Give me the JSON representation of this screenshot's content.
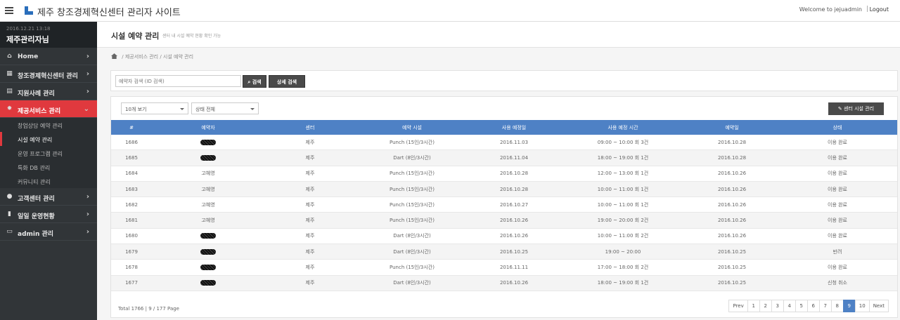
{
  "topbar": {
    "title": "제주 창조경제혁신센터 관리자 사이트",
    "welcome": "Welcome to jejuadmin",
    "separator": "|",
    "logout": "Logout"
  },
  "sidebar": {
    "date": "2016.12.21 13:18",
    "user": "제주관리자님",
    "items": [
      {
        "label": "Home",
        "icon": "home-icon"
      },
      {
        "label": "창조경제혁신센터 관리",
        "icon": "building-icon"
      },
      {
        "label": "지원사례 관리",
        "icon": "document-icon"
      },
      {
        "label": "제공서비스 관리",
        "icon": "gear-icon"
      },
      {
        "label": "고객센터 관리",
        "icon": "user-icon"
      },
      {
        "label": "일일 운영현황",
        "icon": "chart-icon"
      },
      {
        "label": "admin 관리",
        "icon": "monitor-icon"
      }
    ],
    "submenu": [
      "창업상담 예약 관리",
      "시설 예약 관리",
      "운영 프로그램 관리",
      "특화 DB 관리",
      "커뮤니티 관리"
    ],
    "active_color": "#e0393e"
  },
  "page": {
    "title": "시설 예약 관리",
    "subtitle": "센터 내 시설 예약 현황 확인 가능",
    "breadcrumb": "/ 제공서비스 관리 / 시설 예약 관리"
  },
  "search": {
    "placeholder": "예약자 검색 (ID 검색)",
    "search_button": "검색",
    "advanced_button": "상세 검색"
  },
  "filters": {
    "count": "10개 보기",
    "status": "상태 전체",
    "manage_button": "센터 시설 관리"
  },
  "table": {
    "header_color": "#4e81c5",
    "columns": [
      "#",
      "예약자",
      "센터",
      "예약 시설",
      "사용 예정일",
      "사용 예정 시간",
      "예약일",
      "상태"
    ],
    "rows": [
      [
        "1686",
        "",
        "제주",
        "Punch (15인/3시간)",
        "2016.11.03",
        "09:00 ~ 10:00 회 3건",
        "2016.10.28",
        "이용 완료"
      ],
      [
        "1685",
        "",
        "제주",
        "Dart (8인/3시간)",
        "2016.11.04",
        "18:00 ~ 19:00 회 1건",
        "2016.10.28",
        "이용 완료"
      ],
      [
        "1684",
        "고혜영",
        "제주",
        "Punch (15인/3시간)",
        "2016.10.28",
        "12:00 ~ 13:00 회 1건",
        "2016.10.26",
        "이용 완료"
      ],
      [
        "1683",
        "고혜영",
        "제주",
        "Punch (15인/3시간)",
        "2016.10.28",
        "10:00 ~ 11:00 회 1건",
        "2016.10.26",
        "이용 완료"
      ],
      [
        "1682",
        "고혜영",
        "제주",
        "Punch (15인/3시간)",
        "2016.10.27",
        "10:00 ~ 11:00 회 1건",
        "2016.10.26",
        "이용 완료"
      ],
      [
        "1681",
        "고혜영",
        "제주",
        "Punch (15인/3시간)",
        "2016.10.26",
        "19:00 ~ 20:00 회 2건",
        "2016.10.26",
        "이용 완료"
      ],
      [
        "1680",
        "",
        "제주",
        "Dart (8인/3시간)",
        "2016.10.26",
        "10:00 ~ 11:00 회 2건",
        "2016.10.26",
        "이용 완료"
      ],
      [
        "1679",
        "",
        "제주",
        "Dart (8인/3시간)",
        "2016.10.25",
        "19:00 ~ 20:00",
        "2016.10.25",
        "반려"
      ],
      [
        "1678",
        "",
        "제주",
        "Punch (15인/3시간)",
        "2016.11.11",
        "17:00 ~ 18:00 회 2건",
        "2016.10.25",
        "이용 완료"
      ],
      [
        "1677",
        "",
        "제주",
        "Dart (8인/3시간)",
        "2016.10.26",
        "18:00 ~ 19:00 회 1건",
        "2016.10.25",
        "신청 취소"
      ]
    ],
    "redacted": [
      true,
      true,
      false,
      false,
      false,
      false,
      true,
      true,
      true,
      true
    ]
  },
  "footer": {
    "total": "Total 1766 | 9 / 177 Page",
    "pages": [
      "Prev",
      "1",
      "2",
      "3",
      "4",
      "5",
      "6",
      "7",
      "8",
      "9",
      "10",
      "Next"
    ],
    "active_page": "9"
  }
}
